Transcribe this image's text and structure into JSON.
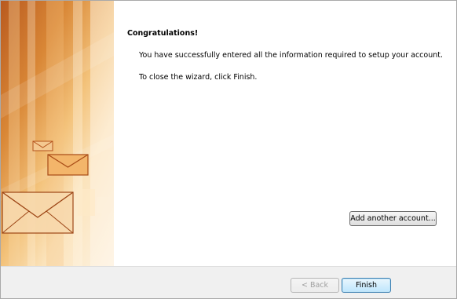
{
  "wizard": {
    "heading": "Congratulations!",
    "message_success": "You have successfully entered all the information required to setup your account.",
    "message_close": "To close the wizard, click Finish.",
    "add_account_label": "Add another account...",
    "back_label": "< Back",
    "finish_label": "Finish",
    "back_enabled": false,
    "side_image": "envelope-banner-image"
  },
  "colors": {
    "banner_dark": "#b95a1f",
    "banner_light": "#fdf3e2",
    "footer_bg": "#f0f0f0",
    "finish_border": "#3c7fb1"
  }
}
